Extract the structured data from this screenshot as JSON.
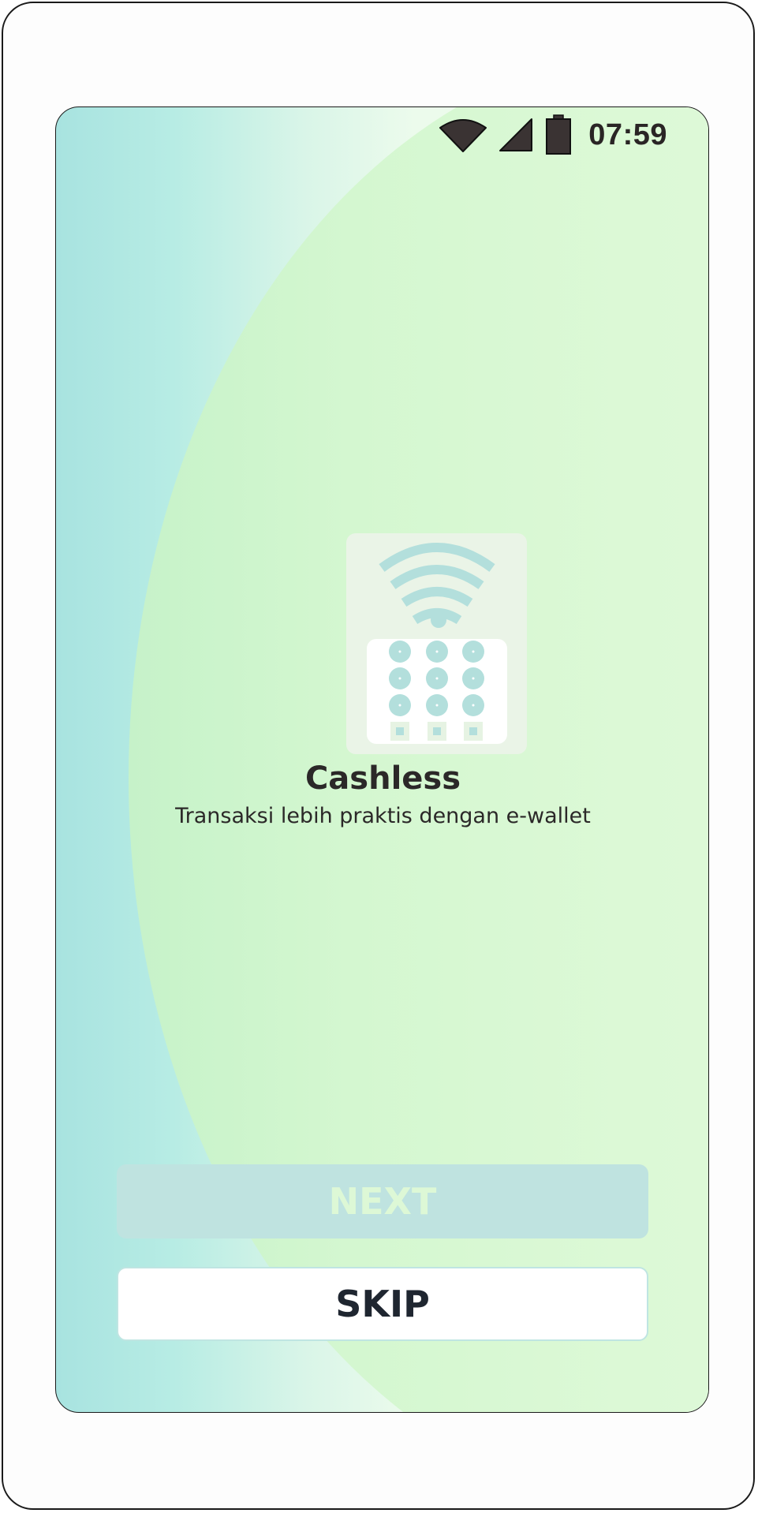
{
  "status_bar": {
    "time": "07:59",
    "icons": [
      "wifi-icon",
      "signal-icon",
      "battery-icon"
    ]
  },
  "onboarding": {
    "illustration": "cashless-payment-terminal-icon",
    "title": "Cashless",
    "subtitle": "Transaksi lebih praktis dengan e-wallet"
  },
  "buttons": {
    "next_label": "NEXT",
    "skip_label": "SKIP"
  },
  "colors": {
    "accent_teal": "#bfe3e0",
    "background_green": "#dcf9d6",
    "text_dark": "#2b2828"
  }
}
